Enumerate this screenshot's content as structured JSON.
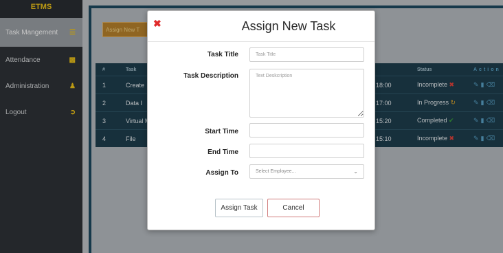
{
  "sidebar": {
    "brand": "ETMS",
    "items": [
      {
        "label": "Task Mangement",
        "icon": "list-icon",
        "active": true
      },
      {
        "label": "Attendance",
        "icon": "calendar-icon",
        "active": false
      },
      {
        "label": "Administration",
        "icon": "user-icon",
        "active": false
      },
      {
        "label": "Logout",
        "icon": "logout-icon",
        "active": false
      }
    ]
  },
  "main": {
    "assign_button": "Assign New T",
    "table": {
      "headers": {
        "num": "#",
        "task": "Task",
        "status": "Status",
        "action": "Action"
      },
      "rows": [
        {
          "num": "1",
          "task": "Create",
          "time": "18:00",
          "status": "Incomplete",
          "status_icon": "x"
        },
        {
          "num": "2",
          "task": "Data I",
          "time": "17:00",
          "status": "In Progress",
          "status_icon": "refresh"
        },
        {
          "num": "3",
          "task": "Virtual M",
          "time": "15:20",
          "status": "Completed",
          "status_icon": "check"
        },
        {
          "num": "4",
          "task": "File",
          "time": "15:10",
          "status": "Incomplete",
          "status_icon": "x"
        }
      ]
    }
  },
  "modal": {
    "title": "Assign New Task",
    "fields": {
      "task_title": {
        "label": "Task Title",
        "placeholder": "Task Title"
      },
      "task_description": {
        "label": "Task Description",
        "placeholder": "Text Deskcription"
      },
      "start_time": {
        "label": "Start Time",
        "value": ""
      },
      "end_time": {
        "label": "End Time",
        "value": ""
      },
      "assign_to": {
        "label": "Assign To",
        "selected": "Select Employee..."
      }
    },
    "buttons": {
      "assign": "Assign Task",
      "cancel": "Cancel"
    }
  },
  "colors": {
    "sidebar_bg": "#2f3338",
    "brand": "#f0c419",
    "table_bg": "#1e3e4e",
    "danger": "#e02a2a",
    "success": "#3aa33a",
    "warning": "#e0a82c"
  }
}
